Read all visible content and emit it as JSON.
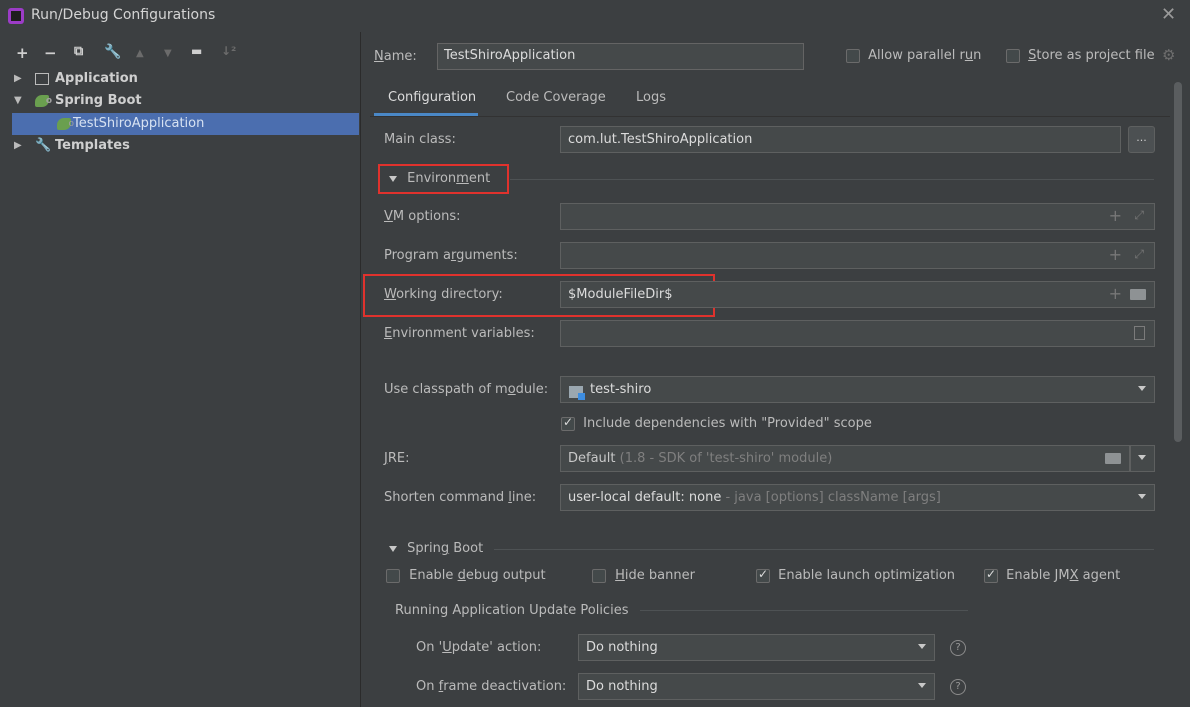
{
  "window": {
    "title": "Run/Debug Configurations",
    "close_icon": "close-icon"
  },
  "left_toolbar": [
    "add-icon",
    "remove-icon",
    "copy-icon",
    "wrench-icon",
    "move-up-icon",
    "move-down-icon",
    "folder-add-icon",
    "sort-icon"
  ],
  "tree": {
    "application": "Application",
    "spring_boot": "Spring Boot",
    "test_shiro": "TestShiroApplication",
    "templates": "Templates"
  },
  "header": {
    "name_label_prefix": "",
    "name_label_key": "N",
    "name_label_rest": "ame:",
    "name_value": "TestShiroApplication",
    "allow_parallel_pre": "Allow parallel r",
    "allow_parallel_key": "u",
    "allow_parallel_post": "n",
    "store_project_key": "S",
    "store_project_rest": "tore as project file"
  },
  "tabs": [
    "Configuration",
    "Code Coverage",
    "Logs"
  ],
  "form": {
    "main_class_label": "Main class:",
    "main_class_value": "com.lut.TestShiroApplication",
    "ellipsis": "...",
    "environment_pre": "Environ",
    "environment_key": "m",
    "environment_post": "ent",
    "vm_key": "V",
    "vm_rest": "M options:",
    "program_pre": "Program a",
    "program_key": "r",
    "program_post": "guments:",
    "working_key": "W",
    "working_rest": "orking directory:",
    "working_value": "$ModuleFileDir$",
    "env_vars_key": "E",
    "env_vars_rest": "nvironment variables:",
    "classpath_pre": "Use classpath of m",
    "classpath_key": "o",
    "classpath_post": "dule:",
    "classpath_value": "test-shiro",
    "include_deps": "Include dependencies with \"Provided\" scope",
    "jre_key": "J",
    "jre_rest": "RE:",
    "jre_value": "Default",
    "jre_suffix": "(1.8 - SDK of 'test-shiro' module)",
    "shorten_pre": "Shorten command ",
    "shorten_key": "l",
    "shorten_post": "ine:",
    "shorten_value": "user-local default: none",
    "shorten_suffix": "- java [options] className [args]"
  },
  "spring_boot": {
    "section_pre": "Sprin",
    "section_key": "g",
    "section_post": " Boot",
    "debug_pre": "Enable ",
    "debug_key": "d",
    "debug_post": "ebug output",
    "debug_checked": false,
    "hide_key": "H",
    "hide_rest": "ide banner",
    "hide_checked": false,
    "launch_pre": "Enable launch optimi",
    "launch_key": "z",
    "launch_post": "ation",
    "launch_checked": true,
    "jmx_pre": "Enable JM",
    "jmx_key": "X",
    "jmx_post": " agent",
    "jmx_checked": true,
    "policies_title": "Running Application Update Policies",
    "update_pre": "On '",
    "update_key": "U",
    "update_post": "pdate' action:",
    "update_value": "Do nothing",
    "frame_pre": "On ",
    "frame_key": "f",
    "frame_post": "rame deactivation:",
    "frame_value": "Do nothing",
    "help_glyph": "?"
  },
  "colors": {
    "background": "#3c3f41",
    "selection": "#4b6eaf",
    "highlight_box": "#e0322d",
    "tab_underline": "#4a88c7"
  }
}
